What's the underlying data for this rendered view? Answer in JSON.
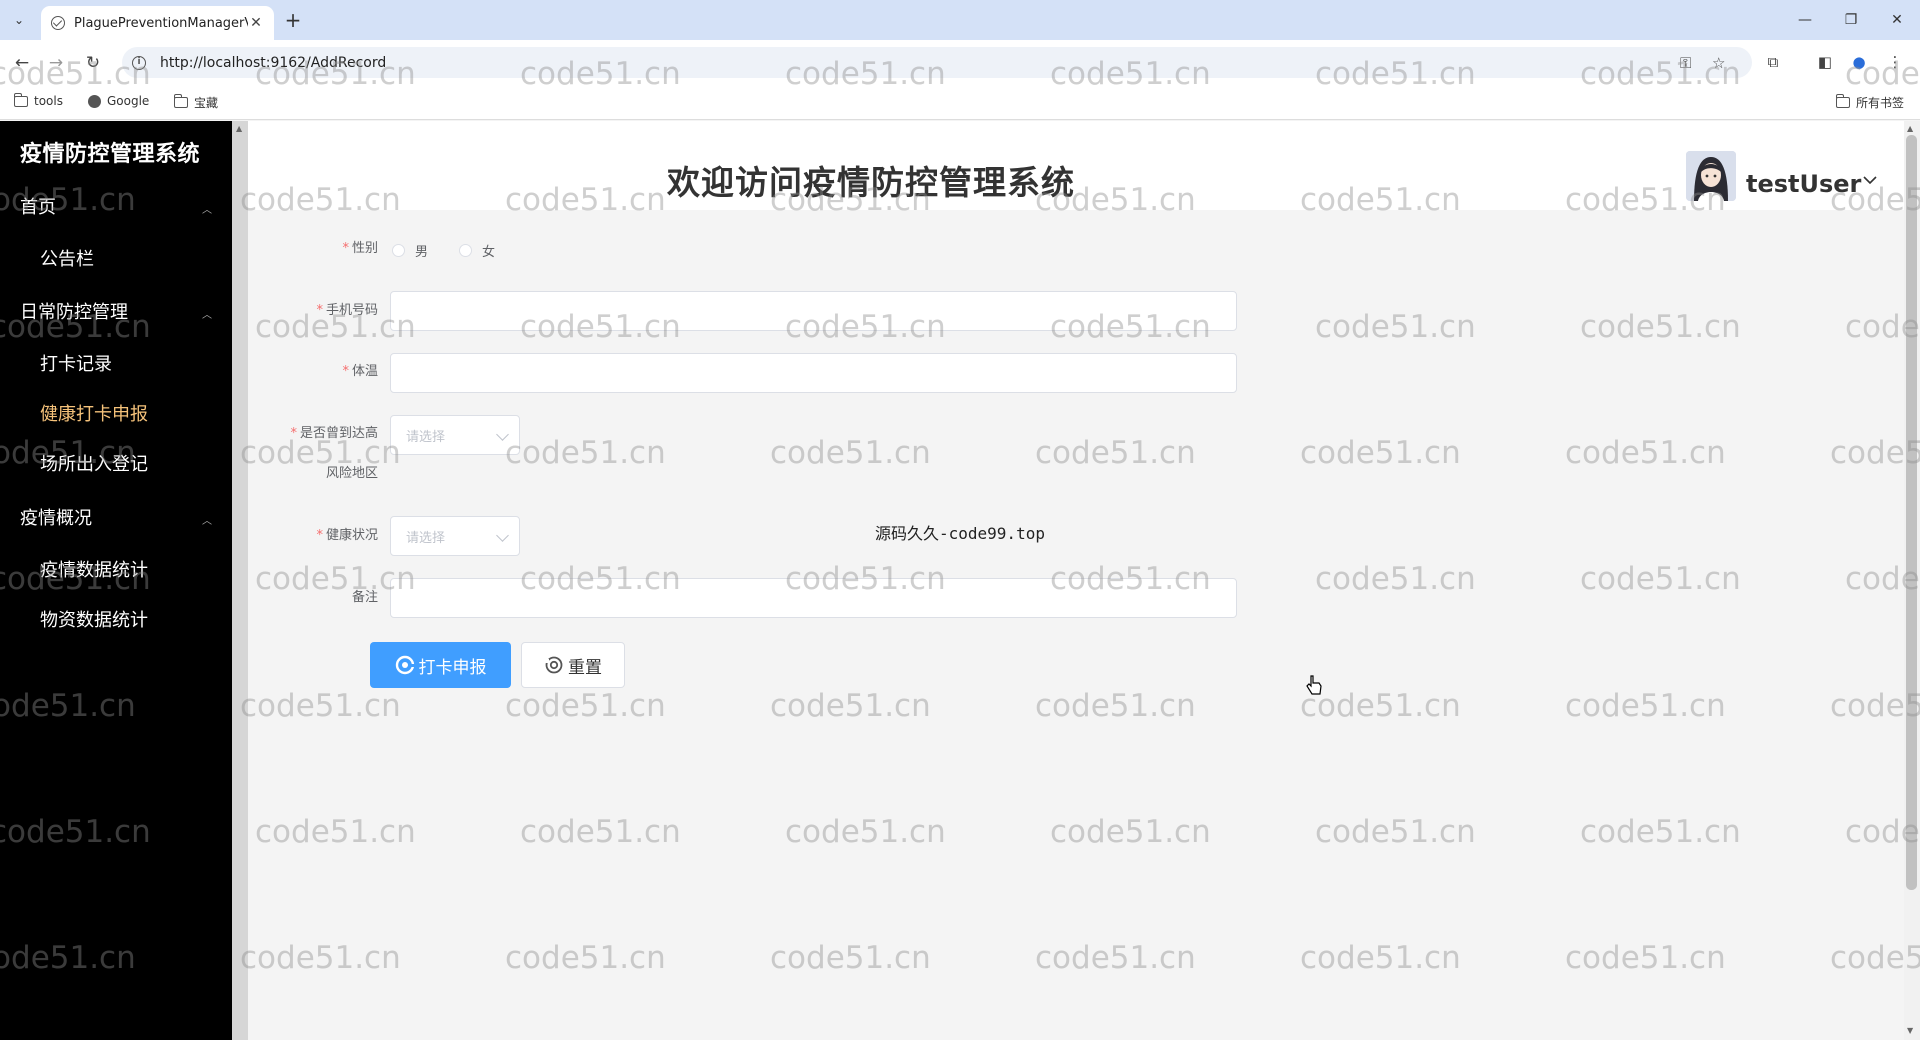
{
  "browser": {
    "tab_title": "PlaguePreventionManagerV",
    "url": "http://localhost:9162/AddRecord",
    "bookmarks": [
      "tools",
      "Google",
      "宝藏"
    ],
    "all_bookmarks": "所有书签"
  },
  "sidebar": {
    "brand": "疫情防控管理系统",
    "groups": [
      {
        "label": "首页",
        "items": [
          "公告栏"
        ]
      },
      {
        "label": "日常防控管理",
        "items": [
          "打卡记录",
          "健康打卡申报",
          "场所出入登记"
        ]
      },
      {
        "label": "疫情概况",
        "items": [
          "疫情数据统计",
          "物资数据统计"
        ]
      }
    ],
    "active_item": "健康打卡申报",
    "active_color": "#f5c27a"
  },
  "header": {
    "title": "欢迎访问疫情防控管理系统",
    "username": "testUser"
  },
  "form": {
    "gender_label": "性别",
    "gender_options": [
      "男",
      "女"
    ],
    "phone_label": "手机号码",
    "phone_value": "",
    "temp_label": "体温",
    "temp_value": "",
    "risk_label_line1": "是否曾到达高",
    "risk_label_line2": "风险地区",
    "risk_placeholder": "请选择",
    "health_label": "健康状况",
    "health_placeholder": "请选择",
    "remark_label": "备注",
    "remark_value": "",
    "submit_label": "打卡申报",
    "reset_label": "重置",
    "required_mark": "*"
  },
  "overlay_text": "源码久久-code99.top",
  "watermark_text": "code51.cn",
  "colors": {
    "primary": "#409eff",
    "sidebar_bg": "#000000",
    "required": "#f56c6c"
  }
}
